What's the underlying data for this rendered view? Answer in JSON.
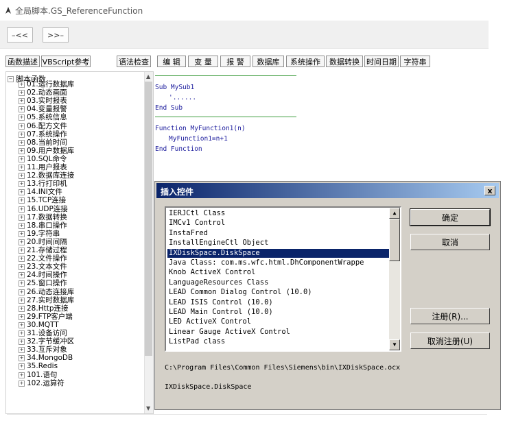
{
  "window": {
    "title": "全局脚本.GS_ReferenceFunction"
  },
  "nav": {
    "back": "–<<",
    "forward": ">>–"
  },
  "tabs": {
    "func_desc": "函数描述",
    "vbs_ref": "VBScript参考",
    "syntax_check": "语法检查",
    "edit": "编 辑",
    "variable": "变 量",
    "alarm": "报 警",
    "database": "数据库",
    "system_ops": "系统操作",
    "data_convert": "数据转换",
    "datetime": "时间日期",
    "string": "字符串"
  },
  "tree": {
    "root": "脚本函数",
    "items": [
      "01.运行数据库",
      "02.动态画面",
      "03.实时报表",
      "04.变量报警",
      "05.系统信息",
      "06.配方文件",
      "07.系统操作",
      "08.当前时间",
      "09.用户数据库",
      "10.SQL命令",
      "11.用户报表",
      "12.数据库连接",
      "13.行打印机",
      "14.INI文件",
      "15.TCP连接",
      "16.UDP连接",
      "17.数据转换",
      "18.串口操作",
      "19.字符串",
      "20.时间间隔",
      "21.存储过程",
      "22.文件操作",
      "23.文本文件",
      "24.时间操作",
      "25.窗口操作",
      "26.动态连接库",
      "27.实时数据库",
      "28.Http连接",
      "29.FTP客户端",
      "30.MQTT",
      "31.设备访问",
      "32.字节缓冲区",
      "33.互斥对象",
      "34.MongoDB",
      "35.Redis",
      "101.语句",
      "102.运算符"
    ]
  },
  "code": {
    "sub_start": "Sub MySub1",
    "sub_body": "'......",
    "sub_end": "End Sub",
    "func_start": "Function MyFunction1(n)",
    "func_body": "MyFunction1=n+1",
    "func_end": "End Function"
  },
  "dialog": {
    "title": "插入控件",
    "close": "x",
    "list": [
      "IERJCtl Class",
      "IMCv1 Control",
      "InstaFred",
      "InstallEngineCtl Object",
      "IXDiskSpace.DiskSpace",
      "Java Class: com.ms.wfc.html.DhComponentWrappe",
      "Knob ActiveX Control",
      "LanguageResources Class",
      "LEAD Common Dialog Control (10.0)",
      "LEAD ISIS Control (10.0)",
      "LEAD Main Control (10.0)",
      "LED ActiveX Control",
      "Linear Gauge ActiveX Control",
      "ListPad class"
    ],
    "selected_index": 4,
    "ok": "确定",
    "cancel": "取消",
    "register": "注册(R)...",
    "unregister": "取消注册(U)",
    "path": "C:\\Program Files\\Common Files\\Siemens\\bin\\IXDiskSpace.ocx",
    "progid": "IXDiskSpace.DiskSpace"
  },
  "colors": {
    "dialog_title": "#0a246a",
    "selection": "#0a246a",
    "code_text": "#1a1a9c",
    "code_separator": "#3a9a3a"
  }
}
